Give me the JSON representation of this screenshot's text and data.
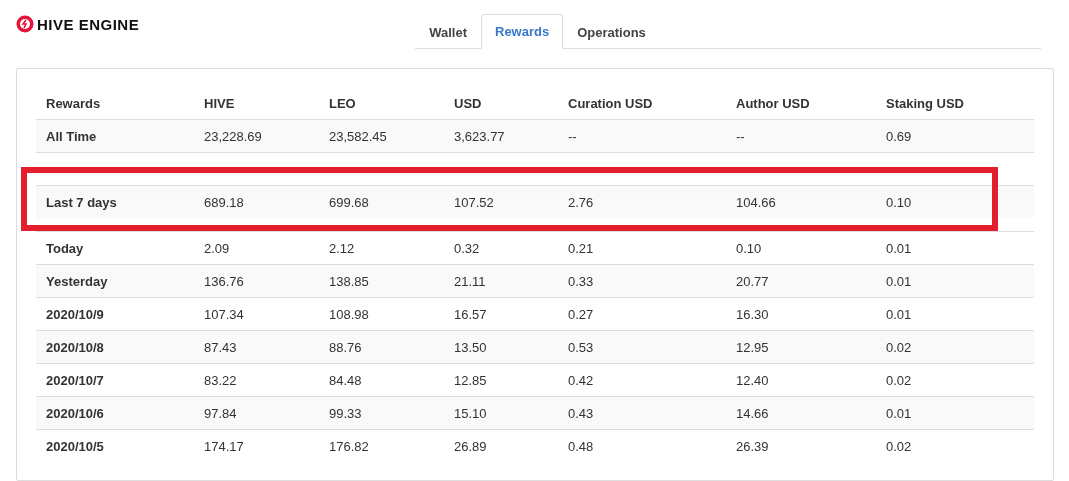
{
  "brand": {
    "name": "HIVE ENGINE"
  },
  "tabs": [
    {
      "label": "Wallet",
      "selected": false
    },
    {
      "label": "Rewards",
      "selected": true
    },
    {
      "label": "Operations",
      "selected": false
    }
  ],
  "table": {
    "columns": [
      "Rewards",
      "HIVE",
      "LEO",
      "USD",
      "Curation USD",
      "Author USD",
      "Staking USD"
    ],
    "rows": [
      {
        "kind": "data",
        "highlighted": false,
        "cells": [
          "All Time",
          "23,228.69",
          "23,582.45",
          "3,623.77",
          "--",
          "--",
          "0.69"
        ]
      },
      {
        "kind": "obscured",
        "highlighted": false,
        "cells": []
      },
      {
        "kind": "data",
        "highlighted": true,
        "cells": [
          "Last 7 days",
          "689.18",
          "699.68",
          "107.52",
          "2.76",
          "104.66",
          "0.10"
        ]
      },
      {
        "kind": "data",
        "highlighted": false,
        "cells": [
          "Today",
          "2.09",
          "2.12",
          "0.32",
          "0.21",
          "0.10",
          "0.01"
        ]
      },
      {
        "kind": "data",
        "highlighted": false,
        "cells": [
          "Yesterday",
          "136.76",
          "138.85",
          "21.11",
          "0.33",
          "20.77",
          "0.01"
        ]
      },
      {
        "kind": "data",
        "highlighted": false,
        "cells": [
          "2020/10/9",
          "107.34",
          "108.98",
          "16.57",
          "0.27",
          "16.30",
          "0.01"
        ]
      },
      {
        "kind": "data",
        "highlighted": false,
        "cells": [
          "2020/10/8",
          "87.43",
          "88.76",
          "13.50",
          "0.53",
          "12.95",
          "0.02"
        ]
      },
      {
        "kind": "data",
        "highlighted": false,
        "cells": [
          "2020/10/7",
          "83.22",
          "84.48",
          "12.85",
          "0.42",
          "12.40",
          "0.02"
        ]
      },
      {
        "kind": "data",
        "highlighted": false,
        "cells": [
          "2020/10/6",
          "97.84",
          "99.33",
          "15.10",
          "0.43",
          "14.66",
          "0.01"
        ]
      },
      {
        "kind": "data",
        "highlighted": false,
        "cells": [
          "2020/10/5",
          "174.17",
          "176.82",
          "26.89",
          "0.48",
          "26.39",
          "0.02"
        ]
      }
    ]
  }
}
